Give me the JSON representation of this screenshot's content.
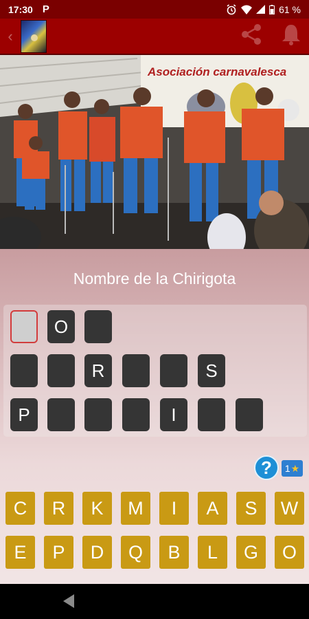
{
  "status_bar": {
    "time": "17:30",
    "app_icon": "P",
    "battery": "61 %"
  },
  "question": "Nombre de la Chirigota",
  "photo": {
    "banner_text": "Asociación carnavalesca"
  },
  "answer": {
    "rows": [
      [
        {
          "letter": "",
          "active": true
        },
        {
          "letter": "O"
        },
        {
          "letter": ""
        }
      ],
      [
        {
          "letter": ""
        },
        {
          "letter": ""
        },
        {
          "letter": "R"
        },
        {
          "letter": ""
        },
        {
          "letter": ""
        },
        {
          "letter": "S"
        }
      ],
      [
        {
          "letter": "P"
        },
        {
          "letter": ""
        },
        {
          "letter": ""
        },
        {
          "letter": ""
        },
        {
          "letter": "I"
        },
        {
          "letter": ""
        },
        {
          "letter": ""
        }
      ]
    ]
  },
  "hint": {
    "label": "?",
    "cost": "1"
  },
  "keyboard": {
    "row1": [
      "C",
      "R",
      "K",
      "M",
      "I",
      "A",
      "S",
      "W"
    ],
    "row2": [
      "E",
      "P",
      "D",
      "Q",
      "B",
      "L",
      "G",
      "O"
    ]
  },
  "colors": {
    "accent": "#9c0000",
    "key": "#c99a14",
    "slot": "#353535",
    "hint": "#1e8fd6"
  }
}
